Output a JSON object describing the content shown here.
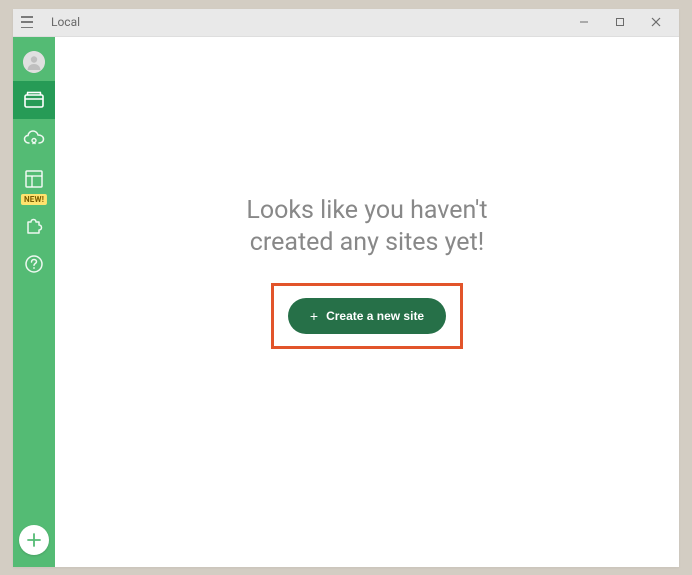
{
  "window": {
    "title": "Local"
  },
  "sidebar": {
    "new_badge": "NEW!"
  },
  "main": {
    "empty_line1": "Looks like you haven't",
    "empty_line2": "created any sites yet!",
    "cta_label": "Create a new site"
  }
}
